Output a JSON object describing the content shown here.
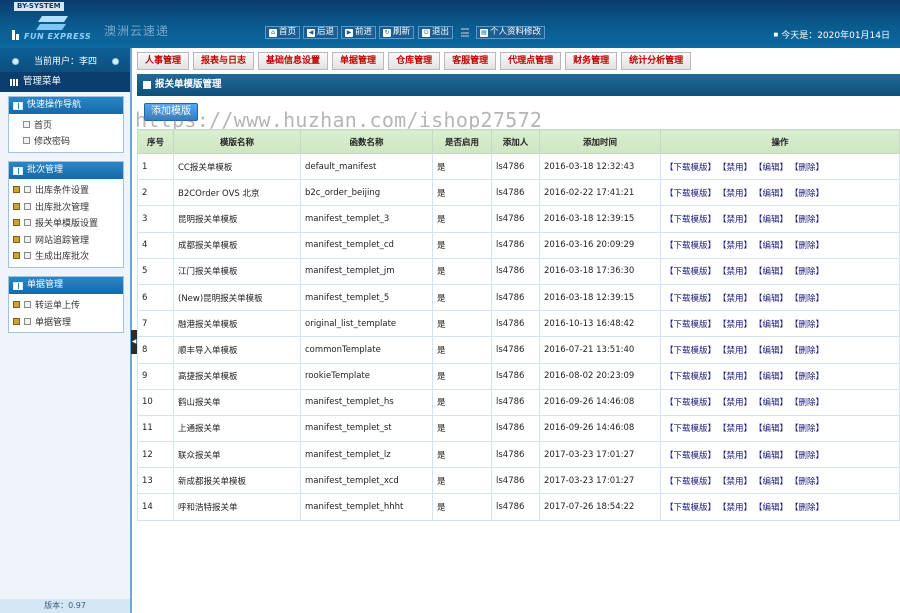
{
  "header": {
    "sys_tag": "BY-SYSTEM",
    "logo_en": "FUN EXPRESS",
    "app_name": "澳洲云速递",
    "toolbar": [
      {
        "label": "首页",
        "icon": "home-icon"
      },
      {
        "label": "后退",
        "icon": "arrow-left-icon"
      },
      {
        "label": "前进",
        "icon": "arrow-right-icon"
      },
      {
        "label": "刷新",
        "icon": "refresh-icon"
      },
      {
        "label": "退出",
        "icon": "power-icon"
      },
      {
        "label": "个人资料修改",
        "icon": "profile-icon"
      }
    ],
    "today": "今天是：2020年01月14日"
  },
  "sidebar": {
    "current_user": "当前用户：李四",
    "menu_title": "管理菜单",
    "groups": [
      {
        "title": "快速操作导航",
        "items": [
          "首页",
          "修改密码"
        ]
      },
      {
        "title": "批次管理",
        "items": [
          "出库条件设置",
          "出库批次管理",
          "报关单模版设置",
          "网站追踪管理",
          "生成出库批次"
        ]
      },
      {
        "title": "单据管理",
        "items": [
          "转运单上传",
          "单据管理"
        ]
      }
    ],
    "version": "版本：0.97"
  },
  "tabs": [
    "人事管理",
    "报表与日志",
    "基础信息设置",
    "单据管理",
    "仓库管理",
    "客服管理",
    "代理点管理",
    "财务管理",
    "统计分析管理"
  ],
  "panel": {
    "title": "报关单模版管理",
    "add_button": "添加模版",
    "watermark": "https://www.huzhan.com/ishop27572"
  },
  "table": {
    "columns": [
      "序号",
      "模版名称",
      "函数名称",
      "是否启用",
      "添加人",
      "添加时间",
      "操作"
    ],
    "actions": [
      "【下载模版】",
      "【禁用】",
      "【编辑】",
      "【删除】"
    ],
    "rows": [
      {
        "no": "1",
        "name": "CC报关单模板",
        "func": "default_manifest",
        "enabled": "是",
        "user": "ls4786",
        "time": "2016-03-18 12:32:43"
      },
      {
        "no": "2",
        "name": "B2COrder OVS 北京",
        "func": "b2c_order_beijing",
        "enabled": "是",
        "user": "ls4786",
        "time": "2016-02-22 17:41:21"
      },
      {
        "no": "3",
        "name": "昆明报关单模板",
        "func": "manifest_templet_3",
        "enabled": "是",
        "user": "ls4786",
        "time": "2016-03-18 12:39:15"
      },
      {
        "no": "4",
        "name": "成都报关单模板",
        "func": "manifest_templet_cd",
        "enabled": "是",
        "user": "ls4786",
        "time": "2016-03-16 20:09:29"
      },
      {
        "no": "5",
        "name": "江门报关单模板",
        "func": "manifest_templet_jm",
        "enabled": "是",
        "user": "ls4786",
        "time": "2016-03-18 17:36:30"
      },
      {
        "no": "6",
        "name": "(New)昆明报关单模板",
        "func": "manifest_templet_5",
        "enabled": "是",
        "user": "ls4786",
        "time": "2016-03-18 12:39:15"
      },
      {
        "no": "7",
        "name": "融港报关单模板",
        "func": "original_list_template",
        "enabled": "是",
        "user": "ls4786",
        "time": "2016-10-13 16:48:42"
      },
      {
        "no": "8",
        "name": "顺丰导入单模板",
        "func": "commonTemplate",
        "enabled": "是",
        "user": "ls4786",
        "time": "2016-07-21 13:51:40"
      },
      {
        "no": "9",
        "name": "高捷报关单模板",
        "func": "rookieTemplate",
        "enabled": "是",
        "user": "ls4786",
        "time": "2016-08-02 20:23:09"
      },
      {
        "no": "10",
        "name": "鹤山报关单",
        "func": "manifest_templet_hs",
        "enabled": "是",
        "user": "ls4786",
        "time": "2016-09-26 14:46:08"
      },
      {
        "no": "11",
        "name": "上通报关单",
        "func": "manifest_templet_st",
        "enabled": "是",
        "user": "ls4786",
        "time": "2016-09-26 14:46:08"
      },
      {
        "no": "12",
        "name": "联众报关单",
        "func": "manifest_templet_lz",
        "enabled": "是",
        "user": "ls4786",
        "time": "2017-03-23 17:01:27"
      },
      {
        "no": "13",
        "name": "新成都报关单模板",
        "func": "manifest_templet_xcd",
        "enabled": "是",
        "user": "ls4786",
        "time": "2017-03-23 17:01:27"
      },
      {
        "no": "14",
        "name": "呼和浩特报关单",
        "func": "manifest_templet_hhht",
        "enabled": "是",
        "user": "ls4786",
        "time": "2017-07-26 18:54:22"
      }
    ]
  },
  "colors": {
    "header_bg": "#0a5b8f",
    "tab_text": "#c00000",
    "table_head": "#d9efd0",
    "action_link": "#1a1a7a"
  }
}
